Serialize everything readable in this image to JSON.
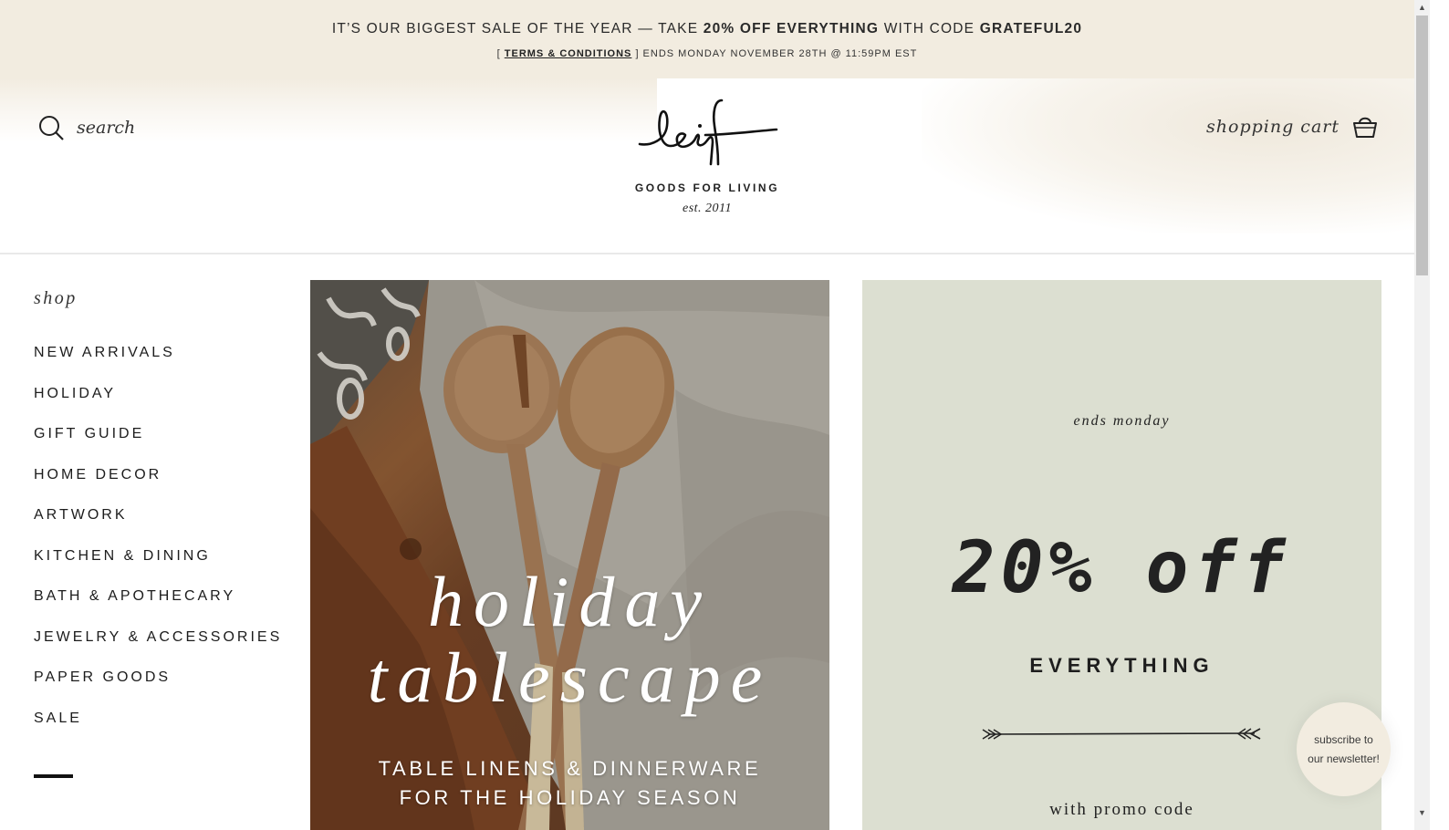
{
  "promo": {
    "line1_pre": "IT’S OUR BIGGEST SALE OF THE YEAR — TAKE ",
    "line1_bold": "20% OFF EVERYTHING",
    "line1_mid": " WITH CODE ",
    "line1_code": "GRATEFUL20",
    "line2_open": "[ ",
    "terms_link": "TERMS & CONDITIONS",
    "line2_close": " ] ENDS MONDAY NOVEMBER 28TH @ 11:59PM EST"
  },
  "header": {
    "search_label": "search",
    "logo_text": "leif",
    "tagline": "GOODS FOR LIVING",
    "established": "est. 2011",
    "cart_label": "shopping cart"
  },
  "sidebar": {
    "title": "shop",
    "items": [
      {
        "label": "NEW ARRIVALS"
      },
      {
        "label": "HOLIDAY"
      },
      {
        "label": "GIFT GUIDE"
      },
      {
        "label": "HOME DECOR"
      },
      {
        "label": "ARTWORK"
      },
      {
        "label": "KITCHEN & DINING"
      },
      {
        "label": "BATH & APOTHECARY"
      },
      {
        "label": "JEWELRY & ACCESSORIES"
      },
      {
        "label": "PAPER GOODS"
      },
      {
        "label": "SALE"
      }
    ]
  },
  "hero": {
    "title_line1": "holiday",
    "title_line2": "tablescape",
    "subtitle_line1": "TABLE LINENS & DINNERWARE",
    "subtitle_line2": "FOR THE HOLIDAY SEASON"
  },
  "sale": {
    "ends": "ends monday",
    "discount": "20% off",
    "everything": "EVERYTHING",
    "promo": "with promo code"
  },
  "newsletter": {
    "label": "subscribe to our newsletter!"
  },
  "colors": {
    "banner_bg": "#f2ece0",
    "sale_panel_bg": "#dcdfd1",
    "text": "#1c1c1c"
  },
  "icons": {
    "search": "search-icon",
    "cart": "basket-icon"
  }
}
